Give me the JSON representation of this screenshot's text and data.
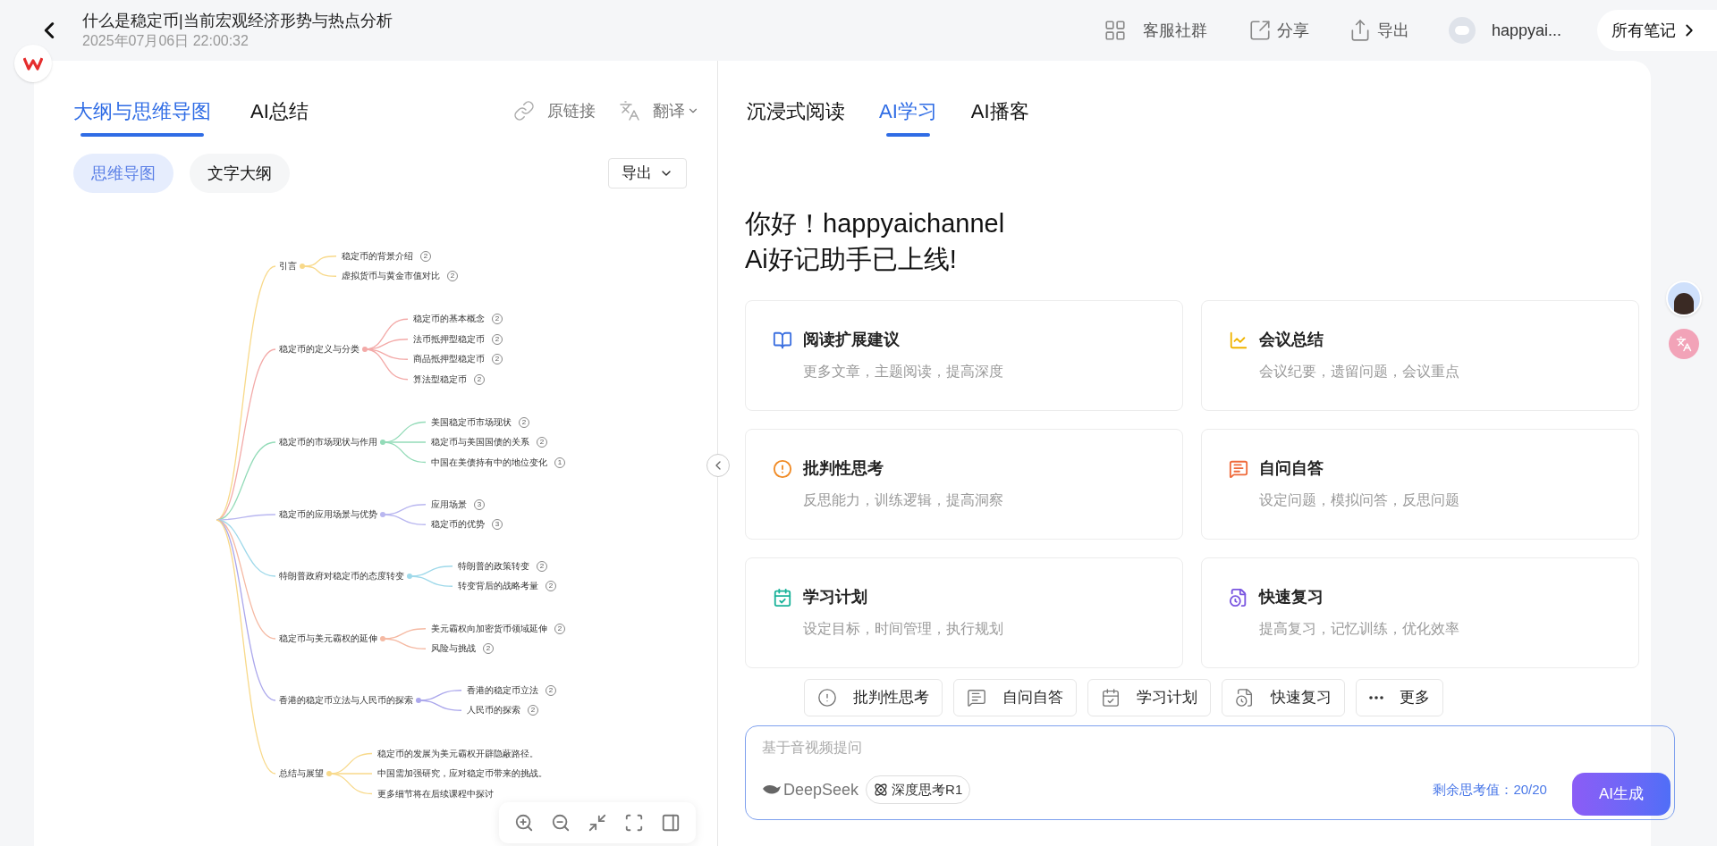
{
  "header": {
    "title": "什么是稳定币|当前宏观经济形势与热点分析",
    "date": "2025年07月06日 22:00:32",
    "actions": [
      {
        "kind": "group",
        "label": "客服社群"
      },
      {
        "kind": "share",
        "label": "分享"
      },
      {
        "kind": "export",
        "label": "导出"
      }
    ],
    "user": {
      "name": "happyai..."
    },
    "all_notes": "所有笔记"
  },
  "left": {
    "tabs": [
      {
        "label": "大纲与思维导图",
        "selected": true
      },
      {
        "label": "AI总结",
        "selected": false
      }
    ],
    "links": [
      {
        "kind": "link",
        "label": "原链接"
      },
      {
        "kind": "translate",
        "label": "翻译"
      }
    ],
    "view_toggle": [
      {
        "label": "思维导图",
        "selected": true
      },
      {
        "label": "文字大纲",
        "selected": false
      }
    ],
    "export_button": "导出",
    "mindmap": {
      "branches": [
        {
          "label": "引言",
          "color": "#f8d98a",
          "children": [
            {
              "label": "稳定币的背景介绍",
              "count": "2"
            },
            {
              "label": "虚拟货币与黄金市值对比",
              "count": "2"
            }
          ]
        },
        {
          "label": "稳定币的定义与分类",
          "color": "#f3aaa8",
          "children": [
            {
              "label": "稳定币的基本概念",
              "count": "2"
            },
            {
              "label": "法币抵押型稳定币",
              "count": "2"
            },
            {
              "label": "商品抵押型稳定币",
              "count": "2"
            },
            {
              "label": "算法型稳定币",
              "count": "2"
            }
          ]
        },
        {
          "label": "稳定币的市场现状与作用",
          "color": "#93dbb8",
          "children": [
            {
              "label": "美国稳定币市场现状",
              "count": "2"
            },
            {
              "label": "稳定币与美国国债的关系",
              "count": "2"
            },
            {
              "label": "中国在美债持有中的地位变化",
              "count": "1"
            }
          ]
        },
        {
          "label": "稳定币的应用场景与优势",
          "color": "#b9b7f0",
          "children": [
            {
              "label": "应用场景",
              "count": "3"
            },
            {
              "label": "稳定币的优势",
              "count": "3"
            }
          ]
        },
        {
          "label": "特朗普政府对稳定币的态度转变",
          "color": "#9fd9ea",
          "children": [
            {
              "label": "特朗普的政策转变",
              "count": "2"
            },
            {
              "label": "转变背后的战略考量",
              "count": "2"
            }
          ]
        },
        {
          "label": "稳定币与美元霸权的延伸",
          "color": "#f5b9a3",
          "children": [
            {
              "label": "美元霸权向加密货币领域延伸",
              "count": "2"
            },
            {
              "label": "风险与挑战",
              "count": "2"
            }
          ]
        },
        {
          "label": "香港的稳定币立法与人民币的探索",
          "color": "#aba7ec",
          "children": [
            {
              "label": "香港的稳定币立法",
              "count": "2"
            },
            {
              "label": "人民币的探索",
              "count": "2"
            }
          ]
        },
        {
          "label": "总结与展望",
          "color": "#f8d98a",
          "children": [
            {
              "label": "稳定币的发展为美元霸权开辟隐蔽路径。"
            },
            {
              "label": "中国需加强研究，应对稳定币带来的挑战。"
            },
            {
              "label": "更多细节将在后续课程中探讨"
            }
          ]
        }
      ]
    }
  },
  "right": {
    "tabs": [
      {
        "label": "沉浸式阅读",
        "selected": false
      },
      {
        "label": "AI学习",
        "selected": true
      },
      {
        "label": "AI播客",
        "selected": false
      }
    ],
    "greeting": [
      "你好！happyaichannel",
      "Ai好记助手已上线!"
    ],
    "cards": [
      {
        "kind": "read",
        "title": "阅读扩展建议",
        "description": "更多文章，主题阅读，提高深度"
      },
      {
        "kind": "meeting",
        "title": "会议总结",
        "description": "会议纪要，遗留问题，会议重点"
      },
      {
        "kind": "critical",
        "title": "批判性思考",
        "description": "反思能力，训练逻辑，提高洞察"
      },
      {
        "kind": "qa",
        "title": "自问自答",
        "description": "设定问题，模拟问答，反思问题"
      },
      {
        "kind": "plan",
        "title": "学习计划",
        "description": "设定目标，时间管理，执行规划"
      },
      {
        "kind": "review",
        "title": "快速复习",
        "description": "提高复习，记忆训练，优化效率"
      }
    ],
    "quick_actions": [
      {
        "kind": "critical",
        "label": "批判性思考"
      },
      {
        "kind": "qa",
        "label": "自问自答"
      },
      {
        "kind": "plan",
        "label": "学习计划"
      },
      {
        "kind": "review",
        "label": "快速复习"
      },
      {
        "kind": "more",
        "label": "更多"
      }
    ],
    "input": {
      "placeholder": "基于音视频提问",
      "model": "DeepSeek",
      "deep_think": "深度思考R1",
      "quota": "剩余思考值：20/20",
      "submit": "AI生成"
    }
  }
}
